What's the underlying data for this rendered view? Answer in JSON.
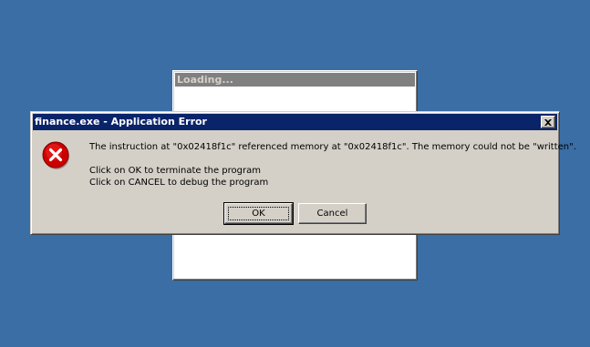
{
  "background_window": {
    "title": "Loading..."
  },
  "dialog": {
    "title": "finance.exe - Application Error",
    "icon": "error-icon",
    "message_line1": "The instruction at \"0x02418f1c\" referenced memory at \"0x02418f1c\". The memory could not be \"written\".",
    "message_line2": "Click on OK to terminate the program",
    "message_line3": "Click on CANCEL to debug the program",
    "ok_label": "OK",
    "cancel_label": "Cancel"
  },
  "colors": {
    "desktop": "#3a6ea5",
    "titlebar_active": "#0a246a",
    "titlebar_inactive": "#808080",
    "dialog_face": "#d4d0c8",
    "error_red": "#cc0000"
  }
}
